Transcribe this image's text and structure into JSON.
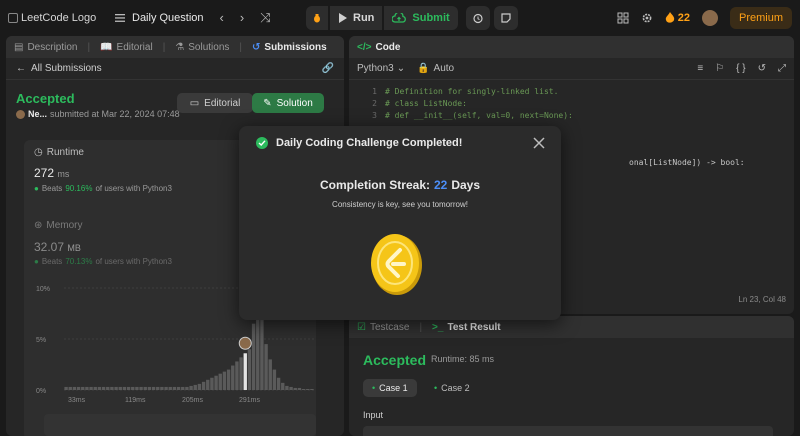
{
  "topbar": {
    "logo_alt": "LeetCode Logo",
    "daily_label": "Daily Question",
    "run_label": "Run",
    "submit_label": "Submit",
    "streak_count": "22",
    "premium_label": "Premium"
  },
  "left": {
    "tabs": [
      {
        "label": "Description"
      },
      {
        "label": "Editorial"
      },
      {
        "label": "Solutions"
      },
      {
        "label": "Submissions"
      }
    ],
    "all_submissions": "All Submissions",
    "status": "Accepted",
    "user": "Ne...",
    "submitted_text": "submitted at Mar 22, 2024 07:48",
    "editorial_btn": "Editorial",
    "solution_btn": "Solution",
    "runtime": {
      "label": "Runtime",
      "value": "272",
      "unit": "ms",
      "beats_prefix": "Beats",
      "beats_pct": "90.16%",
      "beats_suffix": "of users with Python3"
    },
    "memory": {
      "label": "Memory",
      "value": "32.07",
      "unit": "MB",
      "beats_prefix": "Beats",
      "beats_pct": "70.13%",
      "beats_suffix": "of users with Python3"
    }
  },
  "chart_data": {
    "type": "bar",
    "yticks": [
      "10%",
      "5%",
      "0%"
    ],
    "ylim": [
      0,
      10
    ],
    "xticks": [
      "33ms",
      "119ms",
      "205ms",
      "291ms"
    ],
    "values": [
      0.3,
      0.3,
      0.3,
      0.3,
      0.3,
      0.3,
      0.3,
      0.3,
      0.3,
      0.3,
      0.3,
      0.3,
      0.3,
      0.3,
      0.3,
      0.3,
      0.3,
      0.3,
      0.3,
      0.3,
      0.3,
      0.3,
      0.3,
      0.3,
      0.3,
      0.3,
      0.3,
      0.3,
      0.3,
      0.3,
      0.4,
      0.5,
      0.6,
      0.8,
      1.0,
      1.2,
      1.4,
      1.6,
      1.8,
      2.0,
      2.4,
      2.8,
      3.2,
      3.6,
      4.0,
      6.5,
      8.8,
      7.2,
      4.5,
      3.0,
      2.0,
      1.2,
      0.7,
      0.4,
      0.3,
      0.2,
      0.2,
      0.1,
      0.1,
      0.1
    ],
    "highlight_index": 43
  },
  "code": {
    "title": "Code",
    "language": "Python3",
    "mode": "Auto",
    "lines": [
      {
        "n": "1",
        "text": "# Definition for singly-linked list."
      },
      {
        "n": "2",
        "text": "# class ListNode:"
      },
      {
        "n": "3",
        "text": "#     def __init__(self, val=0, next=None):"
      }
    ],
    "partial_line": "onal[ListNode]) -> bool:",
    "cursor": "Ln 23, Col 48"
  },
  "result": {
    "testcase_tab": "Testcase",
    "result_tab": "Test Result",
    "status": "Accepted",
    "runtime": "Runtime: 85 ms",
    "case1": "Case 1",
    "case2": "Case 2",
    "input_label": "Input"
  },
  "modal": {
    "title": "Daily Coding Challenge Completed!",
    "streak_label": "Completion Streak:",
    "streak_value": "22",
    "streak_unit": "Days",
    "tagline": "Consistency is key, see you tomorrow!"
  },
  "colors": {
    "accent_green": "#2cbb5d",
    "accent_orange": "#ffa116",
    "accent_blue": "#4c8ef7"
  }
}
